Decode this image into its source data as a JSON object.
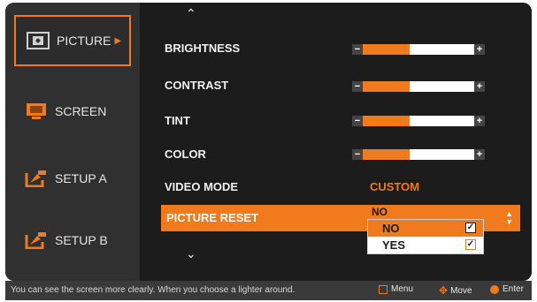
{
  "sidebar": {
    "items": [
      {
        "label": "PICTURE",
        "icon": "picture-icon",
        "active": true
      },
      {
        "label": "SCREEN",
        "icon": "screen-icon"
      },
      {
        "label": "SETUP A",
        "icon": "setup-a-icon"
      },
      {
        "label": "SETUP B",
        "icon": "setup-b-icon"
      }
    ]
  },
  "main": {
    "rows": [
      {
        "label": "BRIGHTNESS",
        "level": 0.42
      },
      {
        "label": "CONTRAST",
        "level": 0.42
      },
      {
        "label": "TINT",
        "level": 0.42
      },
      {
        "label": "COLOR",
        "level": 0.42
      }
    ],
    "video_mode": {
      "label": "VIDEO MODE",
      "value": "CUSTOM"
    },
    "picture_reset": {
      "label": "PICTURE RESET",
      "current": "NO"
    },
    "dropdown": {
      "options": [
        {
          "label": "NO",
          "selected": true
        },
        {
          "label": "YES",
          "selected": false
        }
      ]
    }
  },
  "statusbar": {
    "hint": "You can see the screen more clearly. When you choose a lighter around.",
    "menu": "Menu",
    "move": "Move",
    "enter": "Enter"
  },
  "colors": {
    "accent": "#f07a1c",
    "sidebar_bg": "#303030",
    "main_bg": "#1c1c1c"
  }
}
